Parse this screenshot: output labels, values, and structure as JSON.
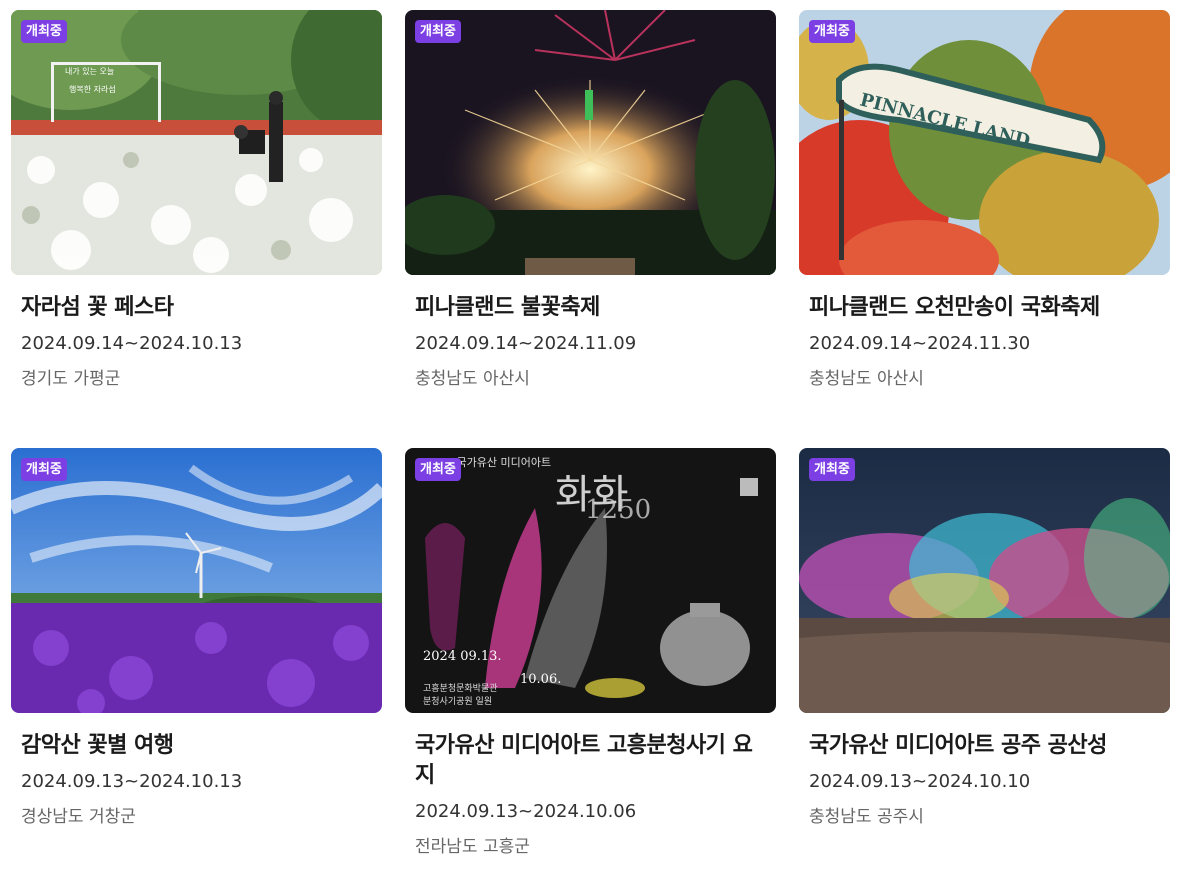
{
  "festivals": [
    {
      "badge": "개최중",
      "title": "자라섬 꽃 페스타",
      "date": "2024.09.14~2024.10.13",
      "region": "경기도 가평군",
      "image": "white flower field with visitors",
      "sign_lines": [
        "내가 있는 오늘",
        "행복한 자라섬"
      ]
    },
    {
      "badge": "개최중",
      "title": "피나클랜드 불꽃축제",
      "date": "2024.09.14~2024.11.09",
      "region": "충청남도 아산시",
      "image": "fireworks over night park"
    },
    {
      "badge": "개최중",
      "title": "피나클랜드 오천만송이 국화축제",
      "date": "2024.09.14~2024.11.30",
      "region": "충청남도 아산시",
      "image": "autumn trees with Pinnacle Land sign",
      "sign_text": "PINNACLE LAND"
    },
    {
      "badge": "개최중",
      "title": "감악산 꽃별 여행",
      "date": "2024.09.13~2024.10.13",
      "region": "경상남도 거창군",
      "image": "purple flower field under blue sky with wind turbine"
    },
    {
      "badge": "개최중",
      "title": "국가유산 미디어아트 고흥분청사기 요지",
      "date": "2024.09.13~2024.10.06",
      "region": "전라남도 고흥군",
      "image": "media art poster with ceramics",
      "poster": {
        "head": "2024 국가유산 미디어아트",
        "big": "화화",
        "num": "1250",
        "date_left": "2024 09.13.",
        "date_right": "10.06.",
        "foot1": "고흥분청문화박물관",
        "foot2": "분청사기공원 일원"
      }
    },
    {
      "badge": "개최중",
      "title": "국가유산 미디어아트 공주 공산성",
      "date": "2024.09.13~2024.10.10",
      "region": "충청남도 공주시",
      "image": "colorful lit trees at night"
    }
  ],
  "colors": {
    "badge": "#7b3fe4",
    "title": "#1a1a1a",
    "date": "#333333",
    "region": "#666666"
  }
}
